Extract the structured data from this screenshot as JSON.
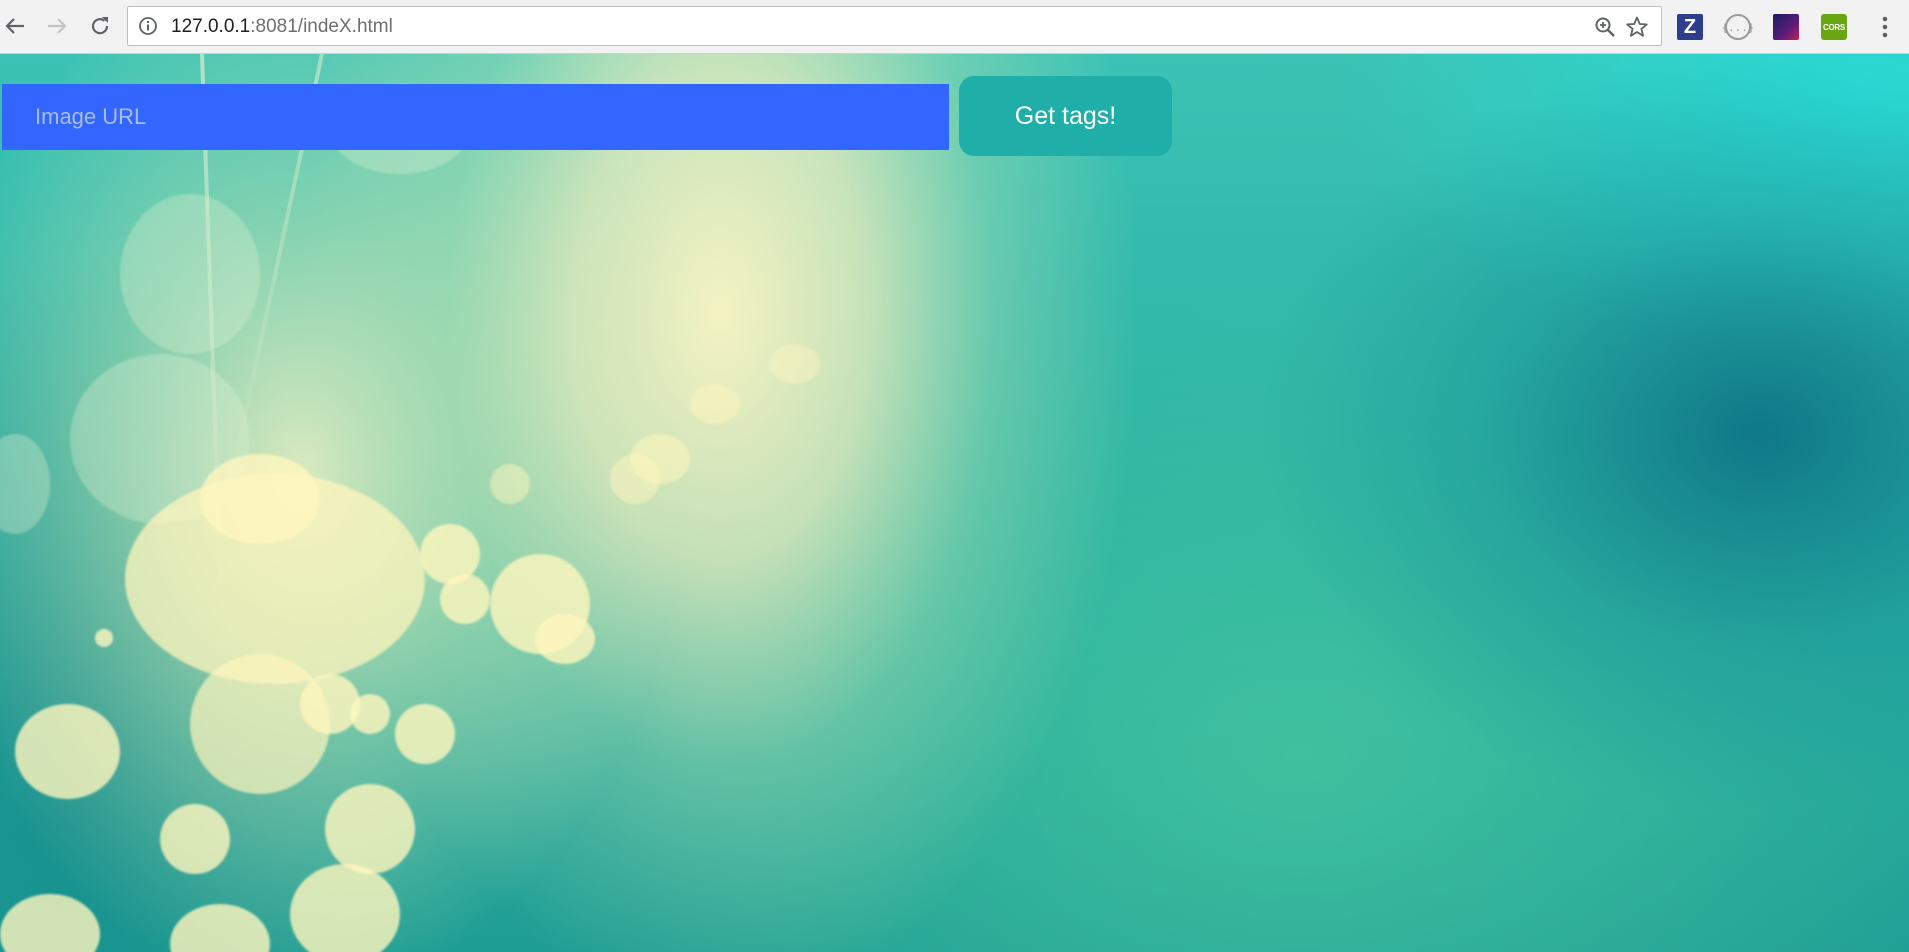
{
  "browser": {
    "address_bar": {
      "host": "127.0.0.1",
      "rest": ":8081/indeX.html"
    },
    "icons": {
      "back": "back-arrow-icon",
      "forward": "forward-arrow-icon",
      "reload": "reload-icon",
      "site_info": "info-icon",
      "zoom": "zoom-icon",
      "bookmark": "star-icon",
      "menu": "menu-icon"
    },
    "extensions": {
      "z_label": "Z",
      "json_label": "{...}",
      "cors_label": "CORS"
    }
  },
  "page": {
    "image_url_input": {
      "placeholder": "Image URL",
      "value": ""
    },
    "get_tags_button": {
      "label": "Get tags!"
    },
    "colors": {
      "input_background": "#3366ff",
      "button_background": "#20afa8",
      "placeholder_text": "#a9bde8"
    }
  }
}
